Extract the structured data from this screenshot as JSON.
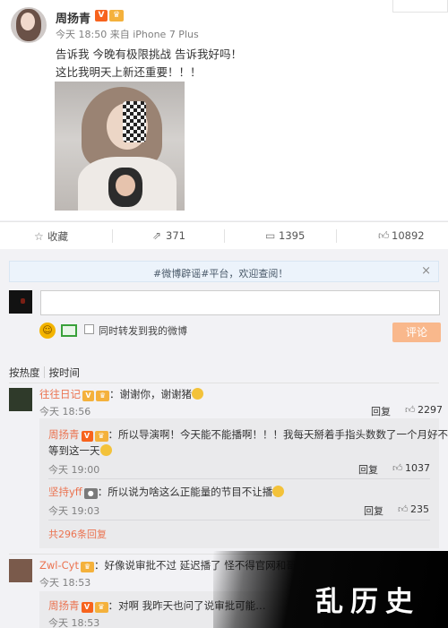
{
  "post": {
    "author": "周扬青",
    "v_badge": "V",
    "crown_badge": "♛",
    "meta": "今天 18:50 来自 iPhone 7 Plus",
    "text_line1": "告诉我 今晚有极限挑战 告诉我好吗！",
    "text_line2": "这比我明天上新还重要！！！"
  },
  "actions": {
    "favorite_label": "收藏",
    "repost_count": "371",
    "comment_count": "1395",
    "like_count": "10892",
    "favorite_icon": "star-icon",
    "repost_icon": "repost-icon",
    "comment_icon": "comment-icon",
    "like_icon": "thumbs-up-icon"
  },
  "comment_box": {
    "notice": "#微博辟谣#平台，欢迎查阅！",
    "close": "×",
    "sync_label": "同时转发到我的微博",
    "submit_label": "评论"
  },
  "sort": {
    "hot": "按热度",
    "time": "按时间"
  },
  "comments": [
    {
      "name": "往往日记",
      "text": "：谢谢你，谢谢猪",
      "time": "今天 18:56",
      "reply": "回复",
      "likes": "2297"
    },
    {
      "name": "Zwl-Cyt",
      "text": "：好像说审批不过 延迟播了 怪不得官网和哥哥们都没一直宣传了",
      "time": "今天 18:53"
    }
  ],
  "replies": [
    {
      "name": "周扬青",
      "text": "：所以导演啊！今天能不能播啊！！！我每天掰着手指头数数了一个月好不容易",
      "text2": "等到这一天",
      "time": "今天 19:00",
      "reply": "回复",
      "likes": "1037"
    },
    {
      "name": "坚持yff",
      "text": "：所以说为啥这么正能量的节目不让播",
      "time": "今天 19:03",
      "reply": "回复",
      "likes": "235"
    }
  ],
  "more_replies": "共296条回复",
  "reply_bottom": {
    "name": "周扬青",
    "text": "：对啊 我昨天也问了说审批可能…",
    "time": "今天 18:53"
  },
  "watermark": "乱历史",
  "colors": {
    "accent_orange": "#eb7350",
    "submit_bg": "#f9b88c",
    "v_badge": "#f7631d"
  }
}
